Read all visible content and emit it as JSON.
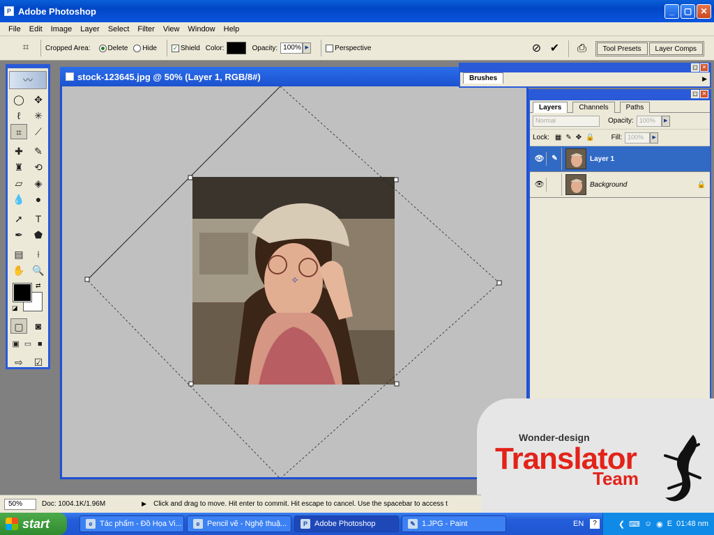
{
  "window": {
    "title": "Adobe Photoshop"
  },
  "menu": [
    "File",
    "Edit",
    "Image",
    "Layer",
    "Select",
    "Filter",
    "View",
    "Window",
    "Help"
  ],
  "options": {
    "cropped_area_label": "Cropped Area:",
    "delete_label": "Delete",
    "hide_label": "Hide",
    "shield_label": "Shield",
    "color_label": "Color:",
    "shield_color": "#000000",
    "opacity_label": "Opacity:",
    "opacity_value": "100%",
    "perspective_label": "Perspective",
    "tool_presets_label": "Tool Presets",
    "layer_comps_label": "Layer Comps"
  },
  "document": {
    "title": "stock-123645.jpg @ 50% (Layer 1, RGB/8#)"
  },
  "brushes": {
    "tab": "Brushes"
  },
  "layers_panel": {
    "tabs": [
      "Layers",
      "Channels",
      "Paths"
    ],
    "blend_mode": "Normal",
    "opacity_label": "Opacity:",
    "opacity_value": "100%",
    "lock_label": "Lock:",
    "fill_label": "Fill:",
    "fill_value": "100%",
    "layers": [
      {
        "name": "Layer 1",
        "selected": true
      },
      {
        "name": "Background",
        "selected": false
      }
    ]
  },
  "status": {
    "zoom": "50%",
    "doc": "Doc: 1004.1K/1.96M",
    "message": "Click and drag to move. Hit enter to commit. Hit escape to cancel. Use the spacebar to access t"
  },
  "watermark": {
    "small": "Wonder-design",
    "big": "Translator",
    "team": "Team"
  },
  "taskbar": {
    "start": "start",
    "tasks": [
      {
        "label": "Tác phẩm - Đồ Họa Vi...",
        "active": false
      },
      {
        "label": "Pencil vẽ - Nghệ thuậ...",
        "active": false
      },
      {
        "label": "Adobe Photoshop",
        "active": true
      },
      {
        "label": "1.JPG - Paint",
        "active": false
      }
    ],
    "lang": "EN",
    "clock": "01:48 nm"
  },
  "colors": {
    "titlebar": "#0046c6",
    "panel": "#ece9d8",
    "accent_red": "#e2231a"
  }
}
